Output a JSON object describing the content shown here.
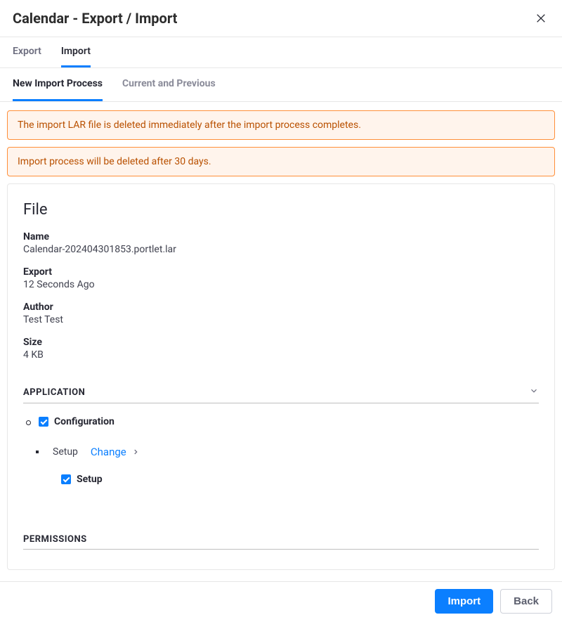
{
  "header": {
    "title": "Calendar - Export / Import"
  },
  "tabs": {
    "export": "Export",
    "import": "Import"
  },
  "subtabs": {
    "new_process": "New Import Process",
    "current_previous": "Current and Previous"
  },
  "alerts": {
    "lar_deleted": "The import LAR file is deleted immediately after the import process completes.",
    "process_deleted": "Import process will be deleted after 30 days."
  },
  "file": {
    "heading": "File",
    "name_label": "Name",
    "name_value": "Calendar-202404301853.portlet.lar",
    "export_label": "Export",
    "export_value": "12 Seconds Ago",
    "author_label": "Author",
    "author_value": "Test Test",
    "size_label": "Size",
    "size_value": "4 KB"
  },
  "sections": {
    "application": "APPLICATION",
    "permissions": "PERMISSIONS"
  },
  "application": {
    "configuration_label": "Configuration",
    "setup_text": "Setup",
    "change_link": "Change",
    "setup_checkbox_label": "Setup"
  },
  "footer": {
    "import": "Import",
    "back": "Back"
  }
}
